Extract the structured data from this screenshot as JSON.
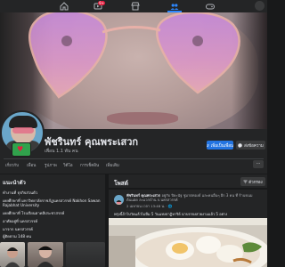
{
  "colors": {
    "background": "#18191a",
    "card": "#242526",
    "accent": "#2374e1",
    "text": "#e4e6eb",
    "muted": "#b0b3b8"
  },
  "topnav": {
    "icons": [
      "home-icon",
      "video-icon",
      "marketplace-icon",
      "groups-icon",
      "gaming-icon"
    ],
    "active": "groups-icon",
    "notification_badge": "9+"
  },
  "profile": {
    "name": "พัชรินทร์ คุณพระเสวก",
    "friends": "เพื่อน 1.1 พัน คน",
    "add_friend_label": "เพิ่มเป็นเพื่อน",
    "message_label": "ส่งข้อความ"
  },
  "tabs": [
    "เกี่ยวกับ",
    "เพื่อน",
    "รูปภาพ",
    "วิดีโอ",
    "การเช็คอิน",
    "เพิ่มเติม"
  ],
  "tab_more_label": "···",
  "intro": {
    "title": "แนะนำตัว",
    "items": [
      "ทำงานที่ ธุรกิจส่วนตัว",
      "เคยศึกษาที่ มหาวิทยาลัยราชภัฏนครสวรรค์ Nakhon Sawan Rajabhat University",
      "เคยศึกษาที่ โรงเรียนตาคลีประชาสรรค์",
      "อาศัยอยู่ที่ นครสวรรค์",
      "มาจาก นครสวรรค์",
      "ผู้ติดตาม 148 คน"
    ]
  },
  "posts": {
    "title": "โพสต์",
    "filter_label": "ตัวกรอง",
    "post": {
      "author": "พัชรินทร์ คุณพระเสวก",
      "header_rest": " อยู่กับ ปิยะนัฐ ชูมาตทองธ์ และคนอื่นๆ อีก 3 คน ที่ ร้านขนม",
      "header_line2": "ต้นแฝด ละแวกบ้าน จ.นครสวรรค์",
      "meta": "2 เมษายน เวลา 13:48 น. · 🌐",
      "text": "พรุ่งนี้ถ้าไปวัดแล้วไม่ลืม 5 วันแห่งปาฏิหาริย์ น่าบรรจงสวยงามแล้ว 5 อย่าง"
    }
  }
}
